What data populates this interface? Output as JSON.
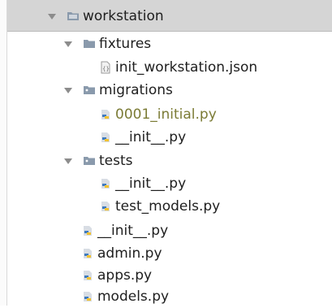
{
  "tree": {
    "root": {
      "label": "workstation"
    },
    "fixtures": {
      "label": "fixtures"
    },
    "fixture_file": {
      "label": "init_workstation.json"
    },
    "migrations": {
      "label": "migrations"
    },
    "migration_initial": {
      "label": "0001_initial.py"
    },
    "migrations_init": {
      "label": "__init__.py"
    },
    "tests": {
      "label": "tests"
    },
    "tests_init": {
      "label": "__init__.py"
    },
    "tests_models": {
      "label": "test_models.py"
    },
    "pkg_init": {
      "label": "__init__.py"
    },
    "admin": {
      "label": "admin.py"
    },
    "apps": {
      "label": "apps.py"
    },
    "models": {
      "label": "models.py"
    }
  },
  "colors": {
    "selected_bg": "#d5d5d5",
    "modified_text": "#7b7b35",
    "folder": "#8a9aac"
  }
}
